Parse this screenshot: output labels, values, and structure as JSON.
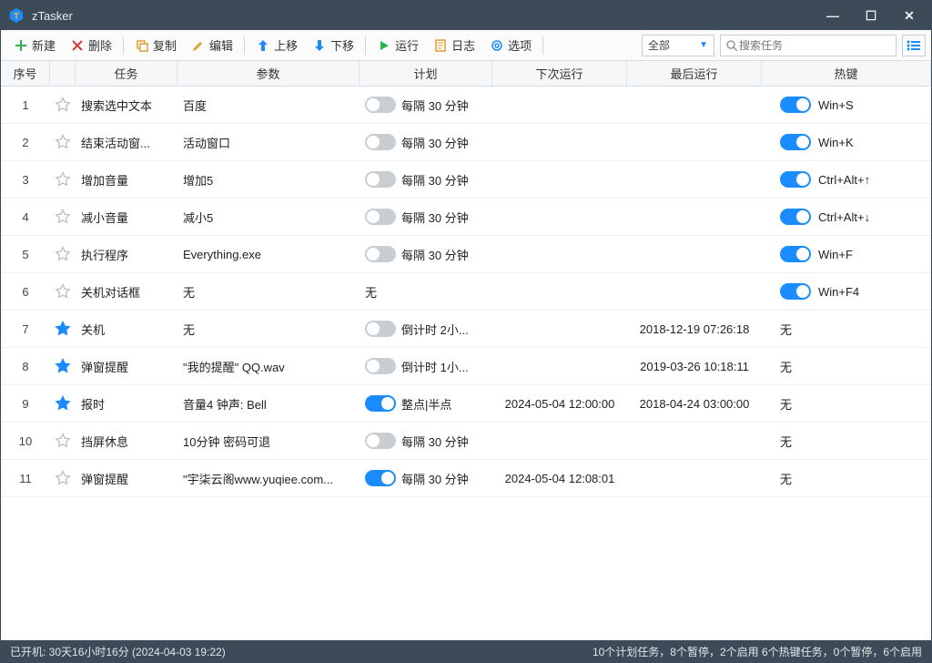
{
  "title": "zTasker",
  "toolbar": {
    "new": "新建",
    "delete": "删除",
    "copy": "复制",
    "edit": "编辑",
    "moveup": "上移",
    "movedown": "下移",
    "run": "运行",
    "log": "日志",
    "options": "选项",
    "filter": "全部",
    "search_placeholder": "搜索任务"
  },
  "columns": {
    "idx": "序号",
    "task": "任务",
    "param": "参数",
    "plan": "计划",
    "next": "下次运行",
    "last": "最后运行",
    "hotkey": "热键"
  },
  "rows": [
    {
      "idx": "1",
      "starred": false,
      "task": "搜索选中文本",
      "param": "百度",
      "plan_on": false,
      "plan": "每隔 30 分钟",
      "next": "",
      "last": "",
      "hot_on": true,
      "hotkey": "Win+S"
    },
    {
      "idx": "2",
      "starred": false,
      "task": "结束活动窗...",
      "param": "活动窗口",
      "plan_on": false,
      "plan": "每隔 30 分钟",
      "next": "",
      "last": "",
      "hot_on": true,
      "hotkey": "Win+K"
    },
    {
      "idx": "3",
      "starred": false,
      "task": "增加音量",
      "param": "增加5",
      "plan_on": false,
      "plan": "每隔 30 分钟",
      "next": "",
      "last": "",
      "hot_on": true,
      "hotkey": "Ctrl+Alt+↑"
    },
    {
      "idx": "4",
      "starred": false,
      "task": "减小音量",
      "param": "减小5",
      "plan_on": false,
      "plan": "每隔 30 分钟",
      "next": "",
      "last": "",
      "hot_on": true,
      "hotkey": "Ctrl+Alt+↓"
    },
    {
      "idx": "5",
      "starred": false,
      "task": "执行程序",
      "param": "Everything.exe",
      "plan_on": false,
      "plan": "每隔 30 分钟",
      "next": "",
      "last": "",
      "hot_on": true,
      "hotkey": "Win+F"
    },
    {
      "idx": "6",
      "starred": false,
      "task": "关机对话框",
      "param": "无",
      "plan_on": null,
      "plan": "无",
      "next": "",
      "last": "",
      "hot_on": true,
      "hotkey": "Win+F4"
    },
    {
      "idx": "7",
      "starred": true,
      "task": "关机",
      "param": "无",
      "plan_on": false,
      "plan": "倒计时 2小...",
      "next": "",
      "last": "2018-12-19 07:26:18",
      "hot_on": null,
      "hotkey": "无"
    },
    {
      "idx": "8",
      "starred": true,
      "task": "弹窗提醒",
      "param": "\"我的提醒\" QQ.wav",
      "plan_on": false,
      "plan": "倒计时 1小...",
      "next": "",
      "last": "2019-03-26 10:18:11",
      "hot_on": null,
      "hotkey": "无"
    },
    {
      "idx": "9",
      "starred": true,
      "task": "报时",
      "param": "音量4 钟声: Bell",
      "plan_on": true,
      "plan": "整点|半点",
      "next": "2024-05-04 12:00:00",
      "last": "2018-04-24 03:00:00",
      "hot_on": null,
      "hotkey": "无"
    },
    {
      "idx": "10",
      "starred": false,
      "task": "挡屏休息",
      "param": "10分钟 密码可退",
      "plan_on": false,
      "plan": "每隔 30 分钟",
      "next": "",
      "last": "",
      "hot_on": null,
      "hotkey": "无"
    },
    {
      "idx": "11",
      "starred": false,
      "task": "弹窗提醒",
      "param": "\"宇柒云阁www.yuqiee.com...",
      "plan_on": true,
      "plan": "每隔 30 分钟",
      "next": "2024-05-04 12:08:01",
      "last": "",
      "hot_on": null,
      "hotkey": "无"
    }
  ],
  "status": {
    "left": "已开机:  30天16小时16分 (2024-04-03 19:22)",
    "right": "10个计划任务，8个暂停，2个启用    6个热键任务，0个暂停，6个启用"
  },
  "colors": {
    "accent": "#1a8cff",
    "titlebar": "#3c4b57"
  }
}
